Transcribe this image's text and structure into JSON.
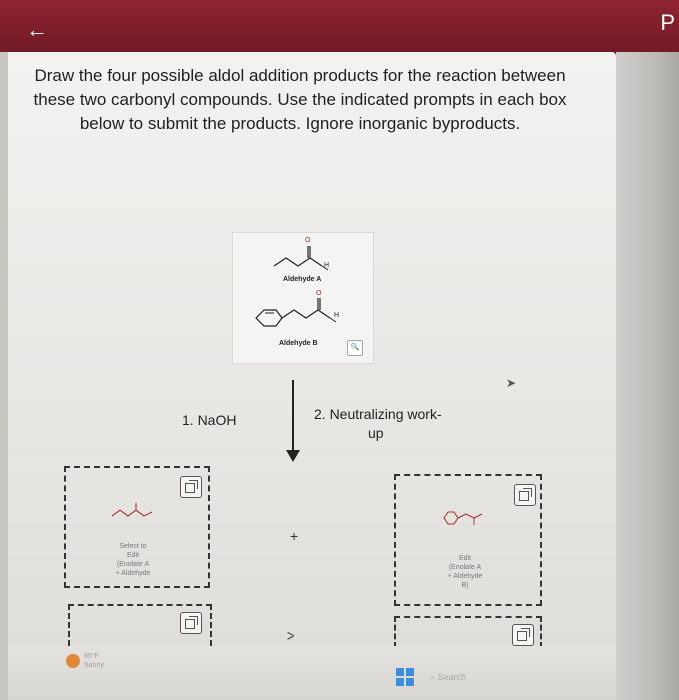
{
  "nav": {
    "back_glyph": "←",
    "corner_letter": "P"
  },
  "question": {
    "text": "Draw the four possible aldol addition products for the reaction between these two carbonyl compounds. Use the indicated prompts in each box below to submit the products. Ignore inorganic byproducts."
  },
  "reactants": {
    "aldehyde_a_label": "Aldehyde A",
    "aldehyde_b_label": "Aldehyde B",
    "o_label": "O",
    "h_label": "H",
    "zoom_glyph": "🔍"
  },
  "conditions": {
    "step1": "1. NaOH",
    "step2_line1": "2. Neutralizing work-",
    "step2_line2": "up"
  },
  "answer_boxes": {
    "box1_caption": [
      "Select to",
      "Edit",
      "(Enolate A",
      "+ Aldehyde"
    ],
    "box2_caption": [
      "Edit",
      "(Enolate A",
      "+ Aldehyde",
      "B)"
    ],
    "plus": "+"
  },
  "nav_more": {
    "chevron": ">"
  },
  "taskbar": {
    "weather_temp": "85°F",
    "weather_desc": "Sunny",
    "search_label": "Search"
  },
  "icons": {
    "back": "back-arrow-icon",
    "zoom": "zoom-icon",
    "edit_box": "edit-box-icon",
    "cursor": "cursor-icon",
    "windows": "windows-icon",
    "search": "search-icon"
  }
}
